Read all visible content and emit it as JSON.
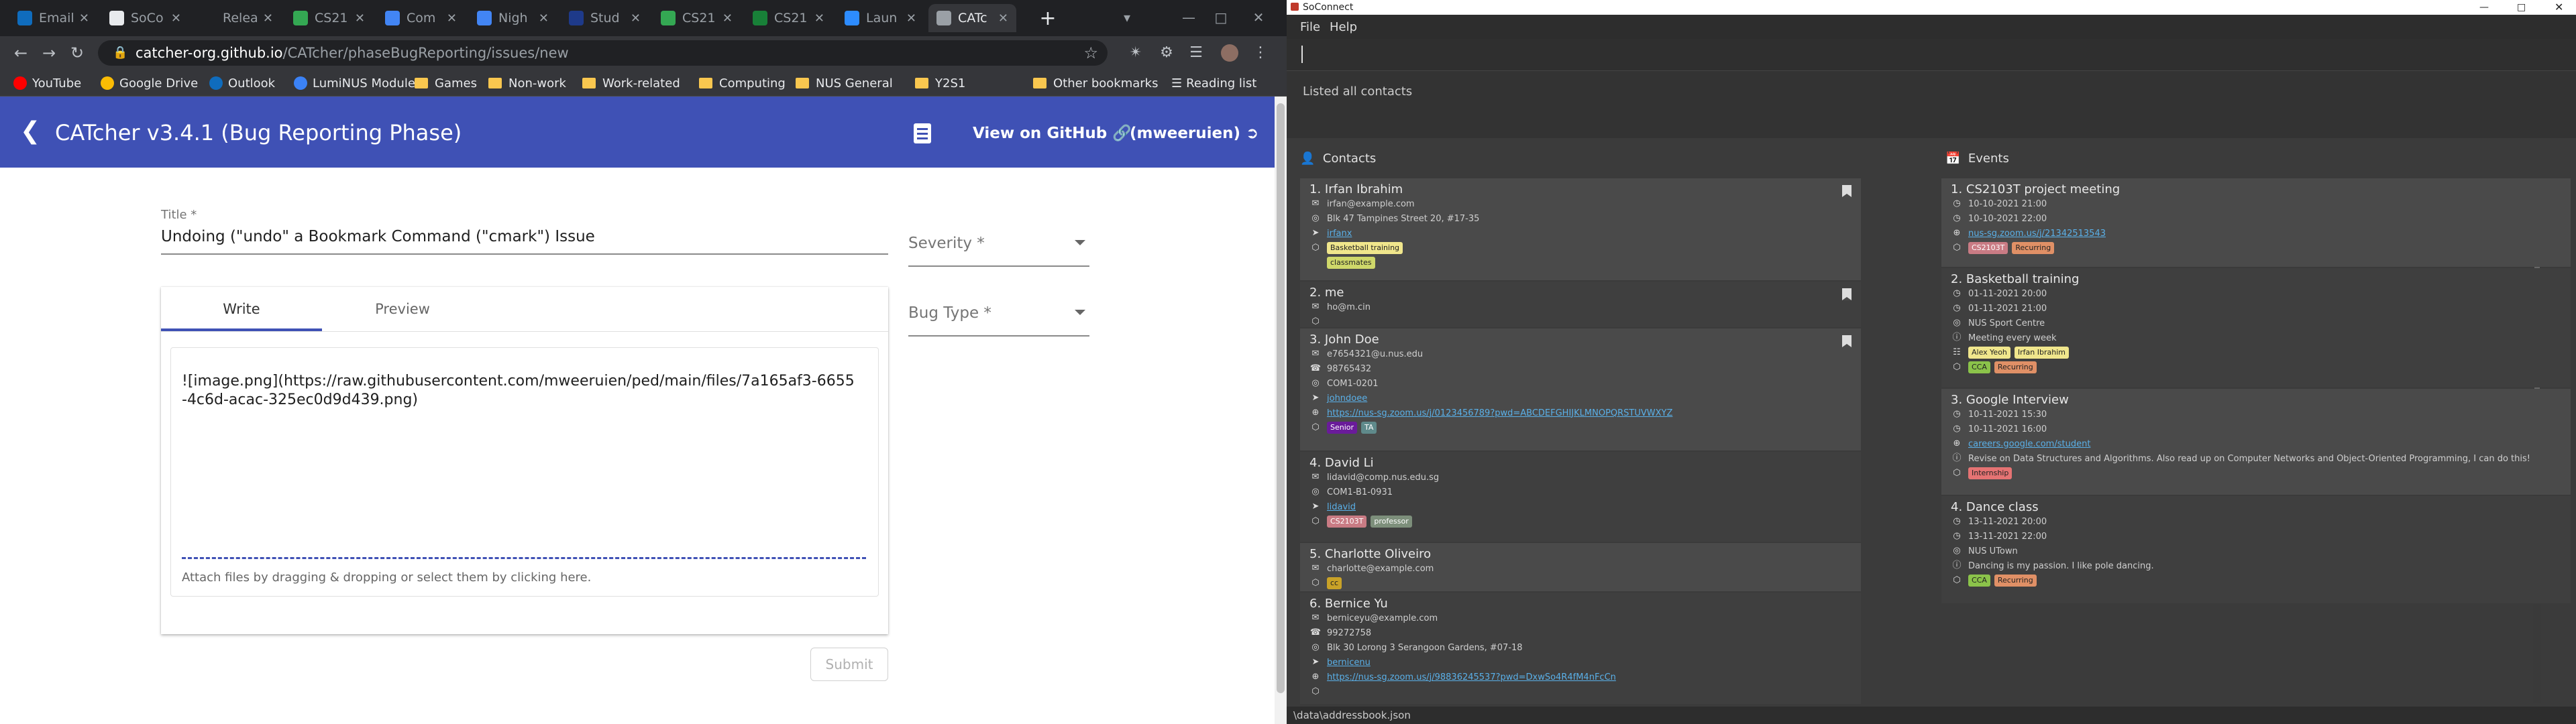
{
  "browser": {
    "tabs": [
      {
        "label": "Email",
        "icon": "outlook-icon",
        "color": "#0f6cbd"
      },
      {
        "label": "SoCo",
        "icon": "chrome-icon",
        "color": "#e8eaed"
      },
      {
        "label": "Relea",
        "icon": "github-icon",
        "color": "#202124"
      },
      {
        "label": "CS21",
        "icon": "mortarboard-icon",
        "color": "#34a853"
      },
      {
        "label": "Com",
        "icon": "docs-icon",
        "color": "#4285f4"
      },
      {
        "label": "Nigh",
        "icon": "docs-icon",
        "color": "#4285f4"
      },
      {
        "label": "Stud",
        "icon": "nus-icon",
        "color": "#1e3a8a"
      },
      {
        "label": "CS21",
        "icon": "mortarboard-icon",
        "color": "#34a853"
      },
      {
        "label": "CS21",
        "icon": "sheets-icon",
        "color": "#188038"
      },
      {
        "label": "Laun",
        "icon": "zoom-icon",
        "color": "#2d8cff"
      },
      {
        "label": "CATc",
        "icon": "catcher-icon",
        "color": "#9aa0a6"
      }
    ],
    "address": {
      "domain": "catcher-org.github.io",
      "path": "/CATcher/phaseBugReporting/issues/new"
    },
    "bookmarks": [
      {
        "label": "YouTube",
        "type": "site",
        "color": "#ff0000"
      },
      {
        "label": "Google Drive",
        "type": "site",
        "color": "#fbbc04"
      },
      {
        "label": "Outlook",
        "type": "site",
        "color": "#0f6cbd"
      },
      {
        "label": "LumiNUS Modules",
        "type": "site",
        "color": "#3b82f6"
      },
      {
        "label": "Games",
        "type": "folder"
      },
      {
        "label": "Non-work",
        "type": "folder"
      },
      {
        "label": "Work-related",
        "type": "folder"
      },
      {
        "label": "Computing",
        "type": "folder"
      },
      {
        "label": "NUS General",
        "type": "folder"
      },
      {
        "label": "Y2S1",
        "type": "folder"
      },
      {
        "label": "Other bookmarks",
        "type": "folder"
      },
      {
        "label": "Reading list",
        "type": "list"
      }
    ]
  },
  "catcher": {
    "app_title": "CATcher v3.4.1  (Bug Reporting Phase)",
    "view_github": "View on GitHub",
    "user": "(mweeruien)",
    "form": {
      "title_label": "Title *",
      "title_value": "Undoing (\"undo\" a Bookmark Command (\"cmark\") Issue",
      "severity_placeholder": "Severity *",
      "bug_type_placeholder": "Bug Type *",
      "tab_write": "Write",
      "tab_preview": "Preview",
      "body": "![image.png](https://raw.githubusercontent.com/mweeruien/ped/main/files/7a165af3-6655-4c6d-acac-325ec0d9d439.png)",
      "attach_hint": "Attach files by dragging & dropping or select them by clicking here.",
      "submit": "Submit"
    },
    "accent": "#3f51b5"
  },
  "soconnect": {
    "window_title": "SoConnect",
    "menu": [
      "File",
      "Help"
    ],
    "result": "Listed all contacts",
    "contacts_label": "Contacts",
    "events_label": "Events",
    "status": "\\data\\addressbook.json",
    "contacts": [
      {
        "name": "1.  Irfan Ibrahim",
        "rows": [
          {
            "icon": "email-icon",
            "text": "irfan@example.com"
          },
          {
            "icon": "location-icon",
            "text": "Blk 47 Tampines Street 20, #17-35"
          },
          {
            "icon": "telegram-icon",
            "text": "irfanx",
            "link": true
          }
        ],
        "tags": [
          {
            "text": "Basketball training",
            "bg": "#f0e68c",
            "fg": "#222"
          }
        ],
        "tags2": [
          {
            "text": "classmates",
            "bg": "#cfd86a",
            "fg": "#222"
          }
        ],
        "bookmarked": true
      },
      {
        "name": "2.  me",
        "rows": [
          {
            "icon": "email-icon",
            "text": "ho@m.cin"
          }
        ],
        "tags": [],
        "bookmarked": true
      },
      {
        "name": "3.  John Doe",
        "rows": [
          {
            "icon": "email-icon",
            "text": "e7654321@u.nus.edu"
          },
          {
            "icon": "phone-icon",
            "text": "98765432"
          },
          {
            "icon": "location-icon",
            "text": "COM1-0201"
          },
          {
            "icon": "telegram-icon",
            "text": "johndoee",
            "link": true
          },
          {
            "icon": "globe-icon",
            "text": "https://nus-sg.zoom.us/j/0123456789?pwd=ABCDEFGHIJKLMNOPQRSTUVWXYZ",
            "link": true
          }
        ],
        "tags": [
          {
            "text": "Senior",
            "bg": "#6a1b9a",
            "fg": "#fff"
          },
          {
            "text": "TA",
            "bg": "#5f8a8b",
            "fg": "#fff"
          }
        ],
        "bookmarked": true
      },
      {
        "name": "4.  David Li",
        "rows": [
          {
            "icon": "email-icon",
            "text": "lidavid@comp.nus.edu.sg"
          },
          {
            "icon": "location-icon",
            "text": "COM1-B1-0931"
          },
          {
            "icon": "telegram-icon",
            "text": "lidavid",
            "link": true
          }
        ],
        "tags": [
          {
            "text": "CS2103T",
            "bg": "#c97b84",
            "fg": "#fff"
          },
          {
            "text": "professor",
            "bg": "#7d8f7b",
            "fg": "#fff"
          }
        ],
        "bookmarked": false
      },
      {
        "name": "5.  Charlotte Oliveiro",
        "rows": [
          {
            "icon": "email-icon",
            "text": "charlotte@example.com"
          }
        ],
        "tags": [
          {
            "text": "cc",
            "bg": "#c9a227",
            "fg": "#222"
          }
        ],
        "bookmarked": false
      },
      {
        "name": "6.  Bernice Yu",
        "rows": [
          {
            "icon": "email-icon",
            "text": "berniceyu@example.com"
          },
          {
            "icon": "phone-icon",
            "text": "99272758"
          },
          {
            "icon": "location-icon",
            "text": "Blk 30 Lorong 3 Serangoon Gardens, #07-18"
          },
          {
            "icon": "telegram-icon",
            "text": "bernicenu",
            "link": true
          },
          {
            "icon": "globe-icon",
            "text": "https://nus-sg.zoom.us/j/98836245537?pwd=DxwSo4R4fM4nFcCn",
            "link": true
          }
        ],
        "tags": [],
        "bookmarked": false
      }
    ],
    "events": [
      {
        "name": "1.  CS2103T project meeting",
        "rows": [
          {
            "icon": "clock-icon",
            "text": "10-10-2021 21:00"
          },
          {
            "icon": "clock-icon",
            "text": "10-10-2021 22:00"
          },
          {
            "icon": "globe-icon",
            "text": "nus-sg.zoom.us/j/21342513543",
            "link": true
          }
        ],
        "tags": [
          {
            "text": "CS2103T",
            "bg": "#c97b84",
            "fg": "#fff"
          },
          {
            "text": "Recurring",
            "bg": "#e09066",
            "fg": "#222"
          }
        ]
      },
      {
        "name": "2.  Basketball training",
        "rows": [
          {
            "icon": "clock-icon",
            "text": "01-11-2021 20:00"
          },
          {
            "icon": "clock-icon",
            "text": "01-11-2021 21:00"
          },
          {
            "icon": "location-icon",
            "text": "NUS Sport Centre"
          },
          {
            "icon": "info-icon",
            "text": "Meeting every week"
          }
        ],
        "people": [
          {
            "text": "Alex Yeoh",
            "bg": "#f0e68c",
            "fg": "#222"
          },
          {
            "text": "Irfan Ibrahim",
            "bg": "#f0e68c",
            "fg": "#222"
          }
        ],
        "tags": [
          {
            "text": "CCA",
            "bg": "#8bc34a",
            "fg": "#222"
          },
          {
            "text": "Recurring",
            "bg": "#e09066",
            "fg": "#222"
          }
        ]
      },
      {
        "name": "3.  Google Interview",
        "rows": [
          {
            "icon": "clock-icon",
            "text": "10-11-2021 15:30"
          },
          {
            "icon": "clock-icon",
            "text": "10-11-2021 16:00"
          },
          {
            "icon": "globe-icon",
            "text": "careers.google.com/student",
            "link": true
          },
          {
            "icon": "info-icon",
            "text": "Revise on Data Structures and Algorithms. Also read up on Computer Networks and Object-Oriented Programming, I can do this!"
          }
        ],
        "tags": [
          {
            "text": "Internship",
            "bg": "#e57373",
            "fg": "#222"
          }
        ]
      },
      {
        "name": "4.  Dance class",
        "rows": [
          {
            "icon": "clock-icon",
            "text": "13-11-2021 20:00"
          },
          {
            "icon": "clock-icon",
            "text": "13-11-2021 22:00"
          },
          {
            "icon": "location-icon",
            "text": "NUS UTown"
          },
          {
            "icon": "info-icon",
            "text": "Dancing is my passion. I like pole dancing."
          }
        ],
        "tags": [
          {
            "text": "CCA",
            "bg": "#8bc34a",
            "fg": "#222"
          },
          {
            "text": "Recurring",
            "bg": "#e09066",
            "fg": "#222"
          }
        ]
      }
    ]
  }
}
